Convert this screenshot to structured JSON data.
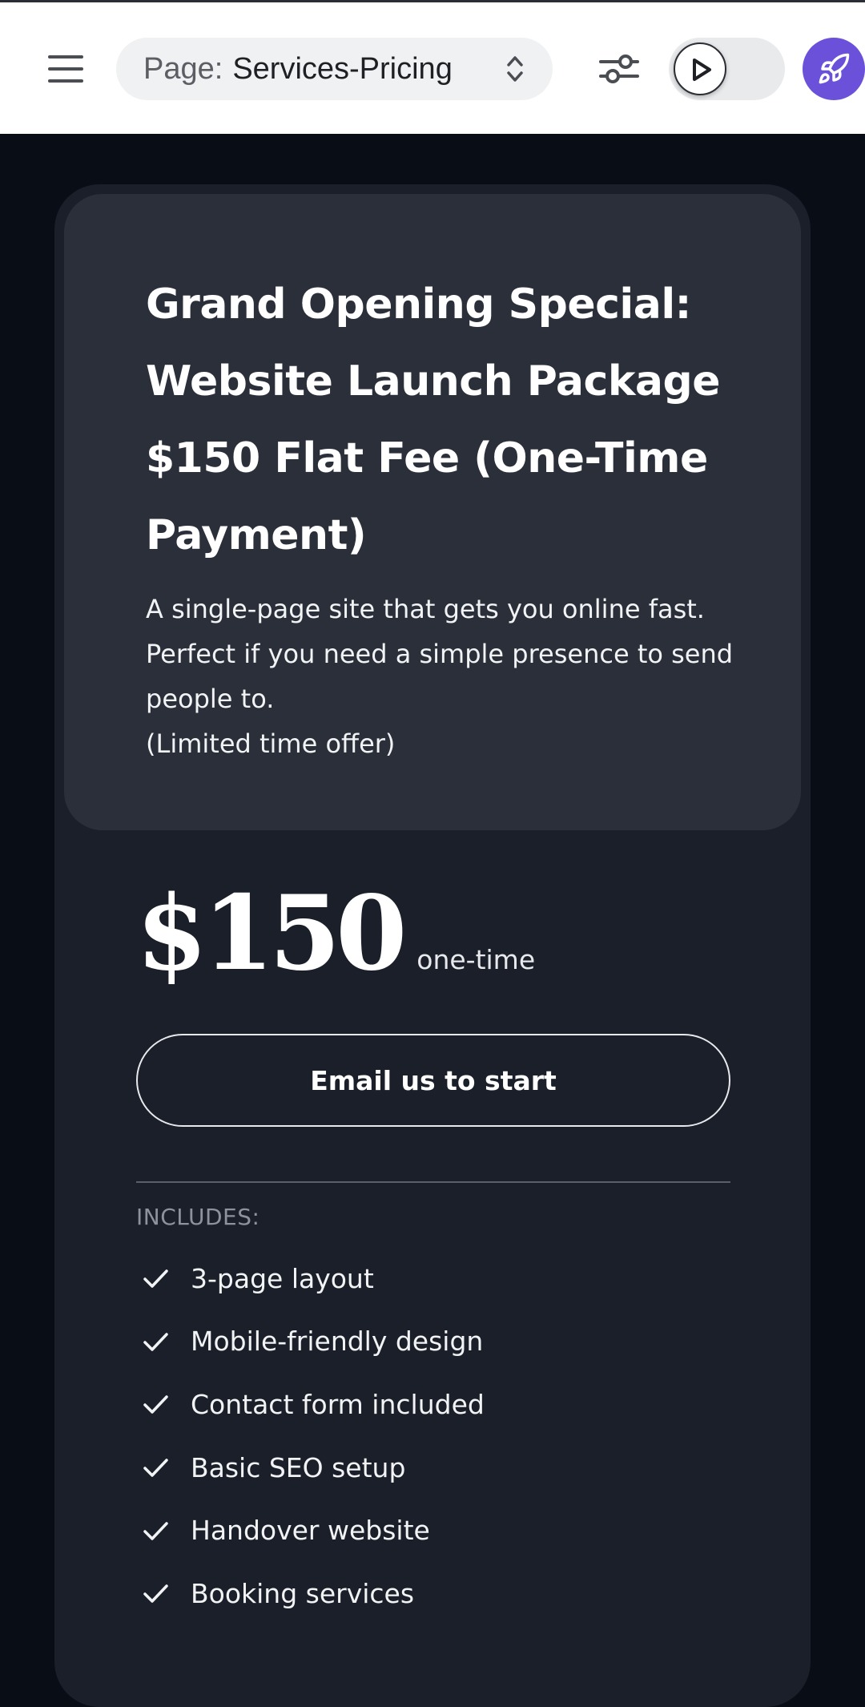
{
  "toolbar": {
    "page_selector": {
      "prefix": "Page:",
      "value": "Services-Pricing"
    },
    "icons": {
      "menu": "hamburger-menu-icon",
      "selector": "chevron-up-down-icon",
      "settings": "sliders-icon",
      "preview": "play-icon",
      "launch": "rocket-icon"
    },
    "launch_color": "#6b50d9"
  },
  "card": {
    "title": "Grand Opening Special: Website Launch Package $150 Flat Fee (One-Time Payment)",
    "description": "A single-page site that gets you online fast.\nPerfect if you need a simple presence to send people to.\n(Limited time offer)",
    "price": "$150",
    "price_unit": "one-time",
    "cta_label": "Email us to start",
    "includes_label": "INCLUDES:",
    "features": [
      "3-page layout",
      "Mobile-friendly design",
      "Contact form included",
      "Basic SEO setup",
      "Handover website",
      "Booking services"
    ],
    "colors": {
      "page_background": "#090d15",
      "card_background": "#1a1f29",
      "card_header_background": "#2a2f39"
    }
  }
}
